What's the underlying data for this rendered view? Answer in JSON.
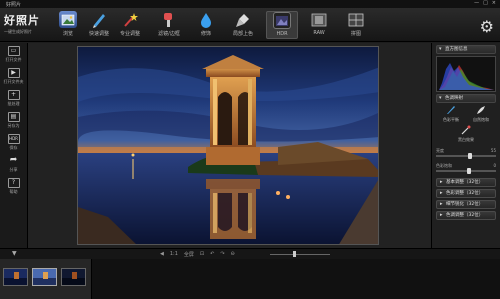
{
  "window": {
    "title": "好照片",
    "controls": [
      "—",
      "□",
      "×"
    ]
  },
  "app": {
    "logo_text": "好照片",
    "logo_tagline": "一键生成好照片"
  },
  "toolbar": {
    "items": [
      {
        "label": "浏览",
        "icon": "image-icon"
      },
      {
        "label": "快速调整",
        "icon": "pen-icon"
      },
      {
        "label": "专业调整",
        "icon": "wand-icon"
      },
      {
        "label": "滤镜/边框",
        "icon": "brush-icon"
      },
      {
        "label": "修饰",
        "icon": "drop-icon"
      },
      {
        "label": "局部上色",
        "icon": "spray-icon"
      },
      {
        "label": "HDR",
        "icon": "hdr-icon"
      },
      {
        "label": "RAW",
        "icon": "film-icon"
      },
      {
        "label": "拼图",
        "icon": "collage-icon"
      }
    ],
    "active": "HDR"
  },
  "left_sidebar": {
    "items": [
      {
        "label": "打开文件",
        "icon": "file-icon"
      },
      {
        "label": "打开文件夹",
        "icon": "folder-play-icon"
      },
      {
        "label": "批处理",
        "icon": "batch-icon"
      },
      {
        "label": "另存为",
        "icon": "save-as-icon"
      },
      {
        "label": "保存",
        "icon": "hdr-save-icon"
      },
      {
        "label": "分享",
        "icon": "share-icon"
      },
      {
        "label": "帮助",
        "icon": "help-icon"
      }
    ]
  },
  "right_panel": {
    "histogram_title": "直方图信息",
    "effects_title": "色调映射",
    "effects": [
      {
        "label": "色彩平衡",
        "icon": "pen-icon"
      },
      {
        "label": "自然饱和",
        "icon": "feather-icon"
      },
      {
        "label": "黑白效果",
        "icon": "brush-icon"
      }
    ],
    "sliders": [
      {
        "label": "亮度",
        "min": "0",
        "max": "55",
        "value": 0.58
      },
      {
        "label": "色彩饱和",
        "min": "0",
        "max": "0",
        "value": 0.55
      }
    ],
    "buttons": [
      "基本调整（32位）",
      "色彩调整（32位）",
      "细节锐化（32位）",
      "色调调整（32位）"
    ]
  },
  "bottom_bar": {
    "controls": [
      "◀",
      "1:1",
      "全屏",
      "⊡",
      "↶",
      "↷",
      "⊖",
      "⊕"
    ],
    "expand_arrow": "▼",
    "zoom_level": 0.38
  },
  "filmstrip": {
    "count": 3,
    "selected_index": 1
  }
}
